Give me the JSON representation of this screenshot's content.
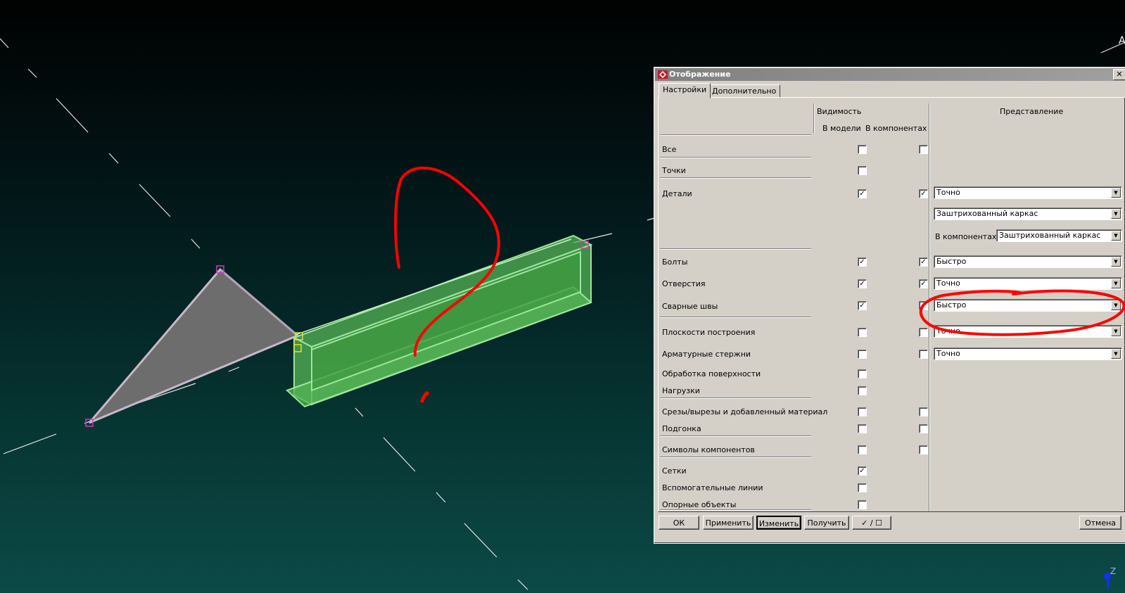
{
  "dialog": {
    "title": "Отображение",
    "tabs": [
      {
        "label": "Настройки",
        "active": true
      },
      {
        "label": "Дополнительно",
        "active": false
      }
    ],
    "headers": {
      "visibility": "Видимость",
      "in_model": "В модели",
      "in_components": "В компонентах",
      "representation": "Представление"
    },
    "rows": [
      {
        "label": "Все",
        "in_model": false,
        "in_components": false
      },
      {
        "label": "Точки",
        "in_model": false
      },
      {
        "label": "Детали",
        "in_model": true,
        "in_components": true,
        "combo": "Точно",
        "combo2": "Заштрихованный каркас",
        "combo3_label": "В компонентах:",
        "combo3": "Заштрихованный каркас"
      },
      {
        "label": "Болты",
        "in_model": true,
        "in_components": true,
        "combo": "Быстро"
      },
      {
        "label": "Отверстия",
        "in_model": true,
        "in_components": true,
        "combo": "Точно"
      },
      {
        "label": "Сварные швы",
        "in_model": true,
        "in_components": true,
        "combo": "Быстро"
      },
      {
        "label": "Плоскости построения",
        "in_model": false,
        "in_components": false,
        "combo": "Точно"
      },
      {
        "label": "Арматурные стержни",
        "in_model": false,
        "in_components": false,
        "combo": "Точно"
      },
      {
        "label": "Обработка поверхности",
        "in_model": false
      },
      {
        "label": "Нагрузки",
        "in_model": false
      },
      {
        "label": "Срезы/вырезы и добавленный материал",
        "in_model": false,
        "in_components": false
      },
      {
        "label": "Подгонка",
        "in_model": false,
        "in_components": false
      },
      {
        "label": "Символы компонентов",
        "in_model": false,
        "in_components": false
      },
      {
        "label": "Сетки",
        "in_model": true
      },
      {
        "label": "Вспомогательные линии",
        "in_model": false
      },
      {
        "label": "Опорные объекты",
        "in_model": false
      }
    ],
    "buttons": {
      "ok": "ОК",
      "apply": "Применить",
      "modify": "Изменить",
      "get": "Получить",
      "toggle": "✓ / ☐",
      "cancel": "Отмена"
    }
  },
  "viewport": {
    "axis_label_top": "A",
    "axis_label_bottom": "Z"
  },
  "check_mark": "✓",
  "icons": {
    "close": "close-icon",
    "app": "tekla-app-icon",
    "combo_arrow": "chevron-down-icon"
  },
  "colors": {
    "beam": "#5fbf5f",
    "plate": "#6d6d6d",
    "annotation": "#ff0000",
    "handle": "#b030b0",
    "selection": "#e0e030"
  }
}
